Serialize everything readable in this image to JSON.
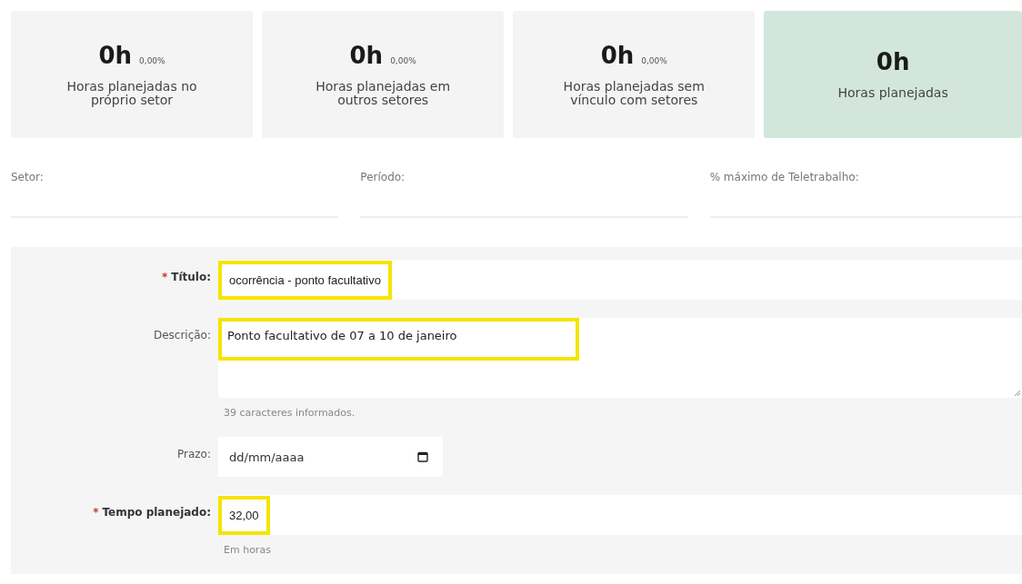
{
  "cards": [
    {
      "hours": "0h",
      "percent": "0,00%",
      "label": "Horas planejadas no próprio setor",
      "kind": "share"
    },
    {
      "hours": "0h",
      "percent": "0,00%",
      "label": "Horas planejadas em outros setores",
      "kind": "share"
    },
    {
      "hours": "0h",
      "percent": "0,00%",
      "label": "Horas planejadas sem vínculo com setores",
      "kind": "share"
    },
    {
      "hours": "0h",
      "label": "Horas planejadas",
      "kind": "total"
    }
  ],
  "filters": [
    {
      "label": "Setor:"
    },
    {
      "label": "Período:"
    },
    {
      "label": "% máximo de Teletrabalho:"
    }
  ],
  "form": [
    {
      "kind": "text",
      "required_mark": "*",
      "label": "Título:",
      "value": "ocorrência - ponto facultativo",
      "highlighted": true
    },
    {
      "kind": "textarea",
      "label": "Descrição:",
      "value": "Ponto facultativo de 07 a 10 de janeiro",
      "highlighted": true,
      "hint": "39 caracteres informados."
    },
    {
      "kind": "date",
      "label": "Prazo:",
      "placeholder": "dd/mm/aaaa"
    },
    {
      "kind": "text",
      "required_mark": "*",
      "label": "Tempo planejado:",
      "value": "32,00",
      "highlighted": true,
      "hint": "Em horas"
    }
  ]
}
